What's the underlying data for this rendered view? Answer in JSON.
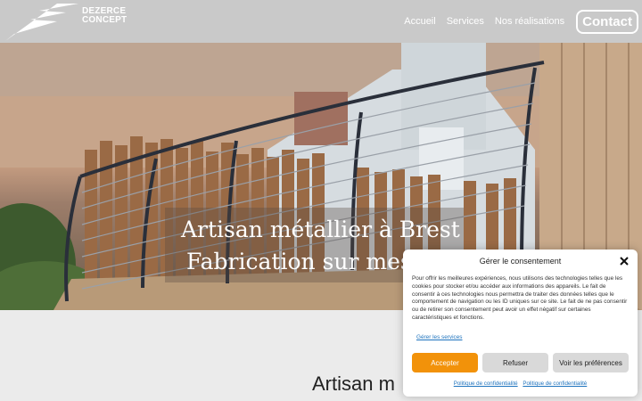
{
  "header": {
    "logo_line1": "DEZERCE",
    "logo_line2": "CONCEPT",
    "nav": [
      "Accueil",
      "Services",
      "Nos réalisations"
    ],
    "contact_label": "Contact"
  },
  "hero": {
    "title_line1": "Artisan métallier à Brest",
    "title_line2": "Fabrication sur mes"
  },
  "lower": {
    "heading": "Artisan m"
  },
  "consent": {
    "title": "Gérer le consentement",
    "body": "Pour offrir les meilleures expériences, nous utilisons des technologies telles que les cookies pour stocker et/ou accéder aux informations des appareils. Le fait de consentir à ces technologies nous permettra de traiter des données telles que le comportement de navigation ou les ID uniques sur ce site. Le fait de ne pas consentir ou de retirer son consentement peut avoir un effet négatif sur certaines caractéristiques et fonctions.",
    "manage_services": "Gérer les services",
    "accept_label": "Accepter",
    "refuse_label": "Refuser",
    "prefs_label": "Voir les préférences",
    "policy1": "Politique de confidentialité",
    "policy2": "Politique de confidentialité"
  },
  "colors": {
    "accent": "#f2920a",
    "header_bg": "#c9c9c9",
    "link": "#1e73be"
  }
}
